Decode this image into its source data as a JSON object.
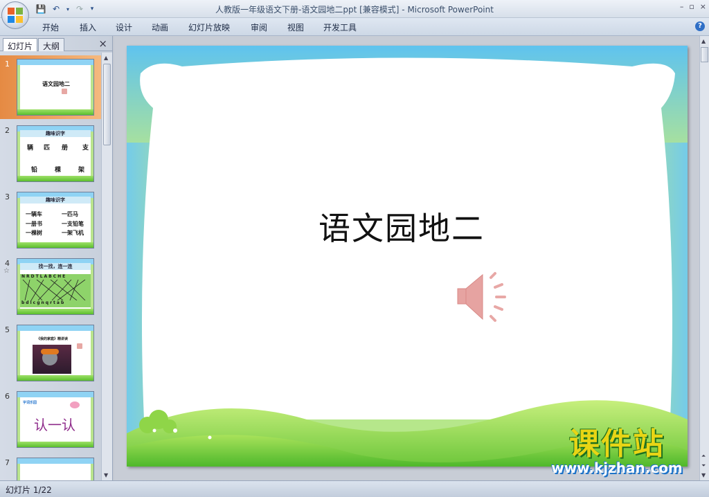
{
  "window": {
    "title": "人教版一年级语文下册-语文园地二ppt [兼容模式] - Microsoft PowerPoint",
    "controls": [
      "–",
      "▫",
      "×"
    ]
  },
  "ribbon": {
    "tabs": [
      "开始",
      "插入",
      "设计",
      "动画",
      "幻灯片放映",
      "审阅",
      "视图",
      "开发工具"
    ],
    "help": "?"
  },
  "left_panel": {
    "tabs": [
      "幻灯片",
      "大纲"
    ],
    "close": "×",
    "thumbnails": [
      {
        "num": "1",
        "title": "语文园地二"
      },
      {
        "num": "2",
        "title": "趣味识字",
        "row1": [
          "辆",
          "匹",
          "册",
          "支"
        ],
        "row2": [
          "铅",
          "棵",
          "架"
        ]
      },
      {
        "num": "3",
        "title": "趣味识字",
        "lines": [
          "一辆车",
          "一匹马",
          "一册书",
          "一支铅笔",
          "一棵树",
          "一架飞机"
        ]
      },
      {
        "num": "4",
        "title": "找一找，连一连",
        "top_letters": "NRDTLABCHE",
        "bottom_letters": "bdlcgnqrtab"
      },
      {
        "num": "5",
        "title": "《我的家庭》精讲读"
      },
      {
        "num": "6",
        "title": "字词乐园",
        "text": "认一认"
      },
      {
        "num": "7"
      }
    ]
  },
  "slide": {
    "title": "语文园地二"
  },
  "watermark": {
    "brand": "课件站",
    "url": "www.kjzhan.com"
  },
  "status": {
    "slide_info": "幻灯片 1/22"
  }
}
